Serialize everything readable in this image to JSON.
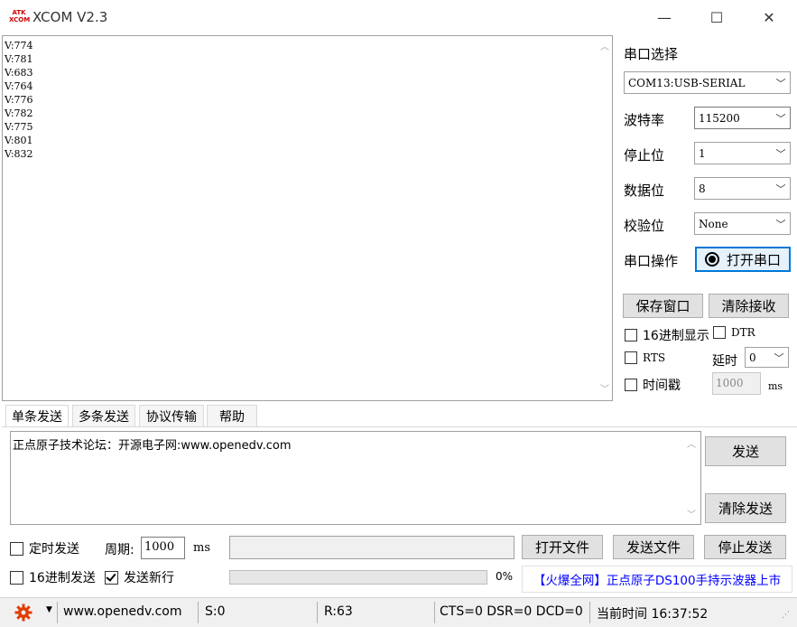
{
  "window": {
    "title": "XCOM V2.3",
    "logo_text": "ATK XCOM",
    "minimize": "—",
    "maximize": "☐",
    "close": "✕"
  },
  "receive": {
    "lines": [
      "V:774",
      "V:781",
      "V:683",
      "V:764",
      "V:776",
      "V:782",
      "V:775",
      "V:801",
      "V:832"
    ]
  },
  "serial": {
    "port_label": "串口选择",
    "port_value": "COM13:USB-SERIAL",
    "baud_label": "波特率",
    "baud_value": "115200",
    "stop_label": "停止位",
    "stop_value": "1",
    "data_label": "数据位",
    "data_value": "8",
    "parity_label": "校验位",
    "parity_value": "None",
    "op_label": "串口操作",
    "open_button": "打开串口",
    "save_window": "保存窗口",
    "clear_receive": "清除接收",
    "hex_display": "16进制显示",
    "dtr": "DTR",
    "rts": "RTS",
    "delay_label": "延时",
    "delay_value": "0",
    "timestamp": "时间戳",
    "timestamp_value": "1000",
    "ms": "ms"
  },
  "tabs": [
    "单条发送",
    "多条发送",
    "协议传输",
    "帮助"
  ],
  "send": {
    "text": "正点原子技术论坛：开源电子网:www.openedv.com",
    "send_button": "发送",
    "clear_send": "清除发送",
    "timed_send": "定时发送",
    "period_label": "周期:",
    "period_value": "1000",
    "ms": "ms",
    "open_file": "打开文件",
    "send_file": "发送文件",
    "stop_send": "停止发送",
    "hex_send": "16进制发送",
    "send_newline": "发送新行",
    "progress": "0%",
    "ad_text": "【火爆全网】正点原子DS100手持示波器上市"
  },
  "status": {
    "url": "www.openedv.com",
    "sent": "S:0",
    "received": "R:63",
    "lines": "CTS=0 DSR=0 DCD=0",
    "time": "当前时间 16:37:52"
  },
  "colors": {
    "accent": "#0078d7",
    "ad_text": "#0000ff",
    "gear": "#e03c00"
  }
}
